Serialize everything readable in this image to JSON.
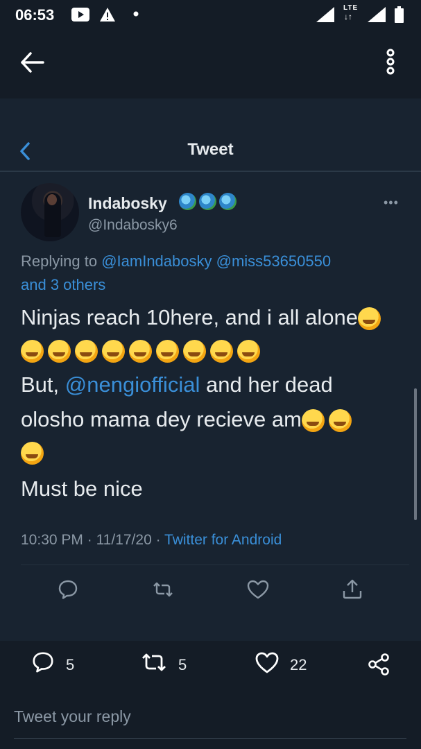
{
  "status_bar": {
    "time": "06:53",
    "icons": [
      "youtube-icon",
      "warning-icon",
      "dot-icon",
      "signal-icon",
      "lte-icon",
      "signal-icon",
      "battery-icon"
    ],
    "network_label": "LTE"
  },
  "app_bar": {
    "back_icon": "back-arrow-icon",
    "menu_icon": "overflow-menu-icon"
  },
  "tweet_view": {
    "header_title": "Tweet",
    "author": {
      "display_name": "Indabosky",
      "handle": "@Indabosky6",
      "badges": [
        "globe-icon",
        "globe-icon",
        "globe-icon"
      ]
    },
    "replying_to": {
      "prefix": "Replying to",
      "user1": "@IamIndabosky",
      "user2": "@miss53650550",
      "others": "and 3 others"
    },
    "body": {
      "line1": "Ninjas reach 10here, and i all alone",
      "line3_prefix": "But,",
      "mention": "@nengiofficial",
      "line3_suffix": "and her dead",
      "line4": "olosho mama dey recieve am",
      "line6": "Must be nice"
    },
    "meta": {
      "time": "10:30 PM",
      "date": "11/17/20",
      "separator": " · ",
      "source": "Twitter for Android"
    },
    "actions": [
      "reply-icon",
      "retweet-icon",
      "like-icon",
      "share-icon"
    ]
  },
  "stats": {
    "replies": "5",
    "retweets": "5",
    "likes": "22"
  },
  "reply": {
    "placeholder": "Tweet your reply"
  },
  "colors": {
    "background": "#182330",
    "text": "#e7ebee",
    "muted": "#8b98a5",
    "link": "#3a8fd8"
  }
}
